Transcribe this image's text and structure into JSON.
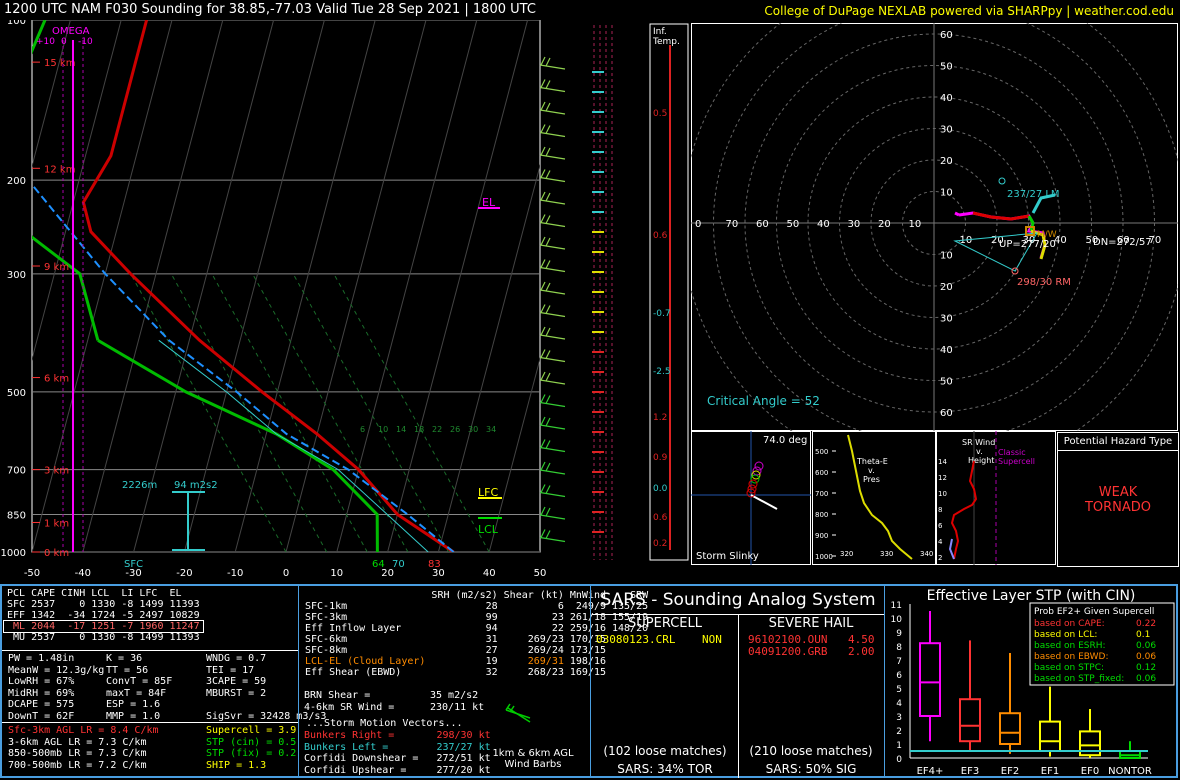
{
  "header": {
    "title": "1200 UTC NAM F030 Sounding for 38.85,-77.03 Valid  Tue 28 Sep 2021 | 1800 UTC",
    "credit": "College of DuPage NEXLAB powered via SHARPpy | weather.cod.edu"
  },
  "skewt": {
    "p_ticks": [
      "100",
      "200",
      "300",
      "500",
      "700",
      "850",
      "1000"
    ],
    "t_ticks": [
      "-50",
      "-40",
      "-30",
      "-20",
      "-10",
      "0",
      "10",
      "20",
      "30",
      "40",
      "50"
    ],
    "heights": [
      "15 km",
      "12 km",
      "9 km",
      "6 km",
      "3 km",
      "1 km",
      "0 km"
    ],
    "omega_label": "OMEGA",
    "omega_ticks": [
      "+10",
      "0",
      "-10"
    ],
    "el_label": "EL",
    "lfc_label": "LFC",
    "lcl_label": "LCL",
    "sfc_label": "SFC",
    "sfc_temp": "64",
    "sfc_dew": "70",
    "sfc_td": "83",
    "effective_inflow_base": "2226m",
    "effective_inflow_srh": "94 m2s2",
    "hodo_inset_speeds": [
      "6",
      "10",
      "14",
      "18",
      "22",
      "26",
      "30",
      "34"
    ]
  },
  "inferred_temp": {
    "label1": "Inf.",
    "label2": "Temp.",
    "values": [
      "0.5",
      "0.6",
      "-0.7",
      "-2.5",
      "1.2",
      "0.9",
      "0.0",
      "0.6",
      "0.2"
    ]
  },
  "hodograph": {
    "ring_labels": [
      "10",
      "20",
      "30",
      "40",
      "50",
      "60"
    ],
    "axis_labels": [
      "0",
      "70",
      "60",
      "50",
      "40",
      "30",
      "20",
      "10"
    ],
    "axis_labels_right": [
      "10",
      "20",
      "30",
      "40",
      "50",
      "60",
      "70"
    ],
    "critical_angle": "Critical Angle = 52",
    "lm_label": "237/27 LM",
    "rm_label": "298/30 RM",
    "up_label": "UP=277/20",
    "dn_label": "DN=272/57",
    "mean_label": "M/W"
  },
  "slinky": {
    "angle": "74.0 deg",
    "label": "Storm Slinky"
  },
  "theta": {
    "title_lines": [
      "Theta-E",
      "v.",
      "Pres"
    ],
    "p_ticks": [
      "500",
      "600",
      "700",
      "800",
      "900",
      "1000"
    ],
    "x_ticks": [
      "320",
      "330",
      "340"
    ]
  },
  "srwind": {
    "title_lines": [
      "SR Wind",
      "v.",
      "Height"
    ],
    "tag_lines": [
      "Classic",
      "Supercell"
    ],
    "h_ticks": [
      "14",
      "12",
      "10",
      "8",
      "6",
      "4",
      "2"
    ]
  },
  "hazard": {
    "title": "Potential Hazard Type",
    "value": "WEAK\nTORNADO"
  },
  "parcels": {
    "headers": [
      "PCL",
      "CAPE",
      "CINH",
      "LCL",
      "LI",
      "LFC",
      "EL"
    ],
    "rows": [
      [
        "SFC",
        "2537",
        "0",
        "1330",
        "-8",
        "1499",
        "11393"
      ],
      [
        "EFF",
        "1342",
        "-34",
        "1724",
        "-5",
        "2497",
        "10829"
      ],
      [
        "ML",
        "2044",
        "-17",
        "1251",
        "-7",
        "1960",
        "11247"
      ],
      [
        "MU",
        "2537",
        "0",
        "1330",
        "-8",
        "1499",
        "11393"
      ]
    ]
  },
  "indices": {
    "col1": [
      "PW = 1.48in",
      "MeanW = 12.3g/kg",
      "LowRH = 67%",
      "MidRH = 69%",
      "DCAPE = 575",
      "DownT = 62F"
    ],
    "col2": [
      "K = 36",
      "TT = 56",
      "ConvT = 85F",
      "maxT = 84F",
      "ESP = 1.6",
      "MMP = 1.0"
    ],
    "col3": [
      "WNDG = 0.7",
      "TEI = 17",
      "3CAPE = 59",
      "MBURST = 2",
      "",
      "SigSvr = 32428 m3/s3"
    ],
    "lapse": [
      "Sfc-3km AGL LR = 8.4 C/km",
      "3-6km AGL LR = 7.3 C/km",
      "850-500mb LR = 7.3 C/km",
      "700-500mb LR = 7.2 C/km"
    ],
    "composite": [
      "Supercell = 3.9",
      "STP (cin) = 0.5",
      "STP (fix) = 0.2",
      "SHIP = 1.3"
    ]
  },
  "kinematics": {
    "headers": [
      "",
      "SRH (m2/s2)",
      "Shear (kt)",
      "MnWind",
      "SRW"
    ],
    "rows": [
      [
        "SFC-1km",
        "28",
        "6",
        "249/9",
        "135/25"
      ],
      [
        "SFC-3km",
        "99",
        "23",
        "261/18",
        "155/19"
      ],
      [
        "Eff Inflow Layer",
        "94",
        "22",
        "259/16",
        "148/20"
      ],
      [
        "",
        "",
        "",
        "",
        ""
      ],
      [
        "SFC-6km",
        "31",
        "269/23",
        "170/15",
        ""
      ],
      [
        "SFC-8km",
        "27",
        "269/24",
        "173/15",
        ""
      ],
      [
        "LCL-EL (Cloud Layer)",
        "19",
        "269/31",
        "198/16",
        ""
      ],
      [
        "Eff Shear (EBWD)",
        "32",
        "268/23",
        "169/15",
        ""
      ]
    ],
    "brn_shear": "BRN Shear =",
    "brn_shear_val": "35 m2/s2",
    "sr_wind": "4-6km SR Wind =",
    "sr_wind_val": "230/11 kt",
    "storm_motion_title": "...Storm Motion Vectors...",
    "motions": [
      [
        "Bunkers Right =",
        "298/30 kt"
      ],
      [
        "Bunkers Left =",
        "237/27 kt"
      ],
      [
        "Corfidi Downshear =",
        "272/51 kt"
      ],
      [
        "Corfidi Upshear =",
        "277/20 kt"
      ]
    ],
    "barb_label1": "1km & 6km AGL",
    "barb_label2": "Wind Barbs"
  },
  "sars": {
    "title": "SARS - Sounding Analog System",
    "supercell_title": "SUPERCELL",
    "hail_title": "SEVERE HAIL",
    "supercell_match": "03080123.CRL",
    "supercell_match_type": "NON",
    "hail_matches": [
      [
        "96102100.OUN",
        "4.50"
      ],
      [
        "04091200.GRB",
        "2.00"
      ]
    ],
    "supercell_loose": "(102 loose matches)",
    "hail_loose": "(210 loose matches)",
    "supercell_stat": "SARS: 34% TOR",
    "hail_stat": "SARS: 50% SIG"
  },
  "stp": {
    "title": "Effective Layer STP (with CIN)",
    "y_ticks": [
      "0",
      "1",
      "2",
      "3",
      "4",
      "5",
      "6",
      "7",
      "8",
      "9",
      "10",
      "11"
    ],
    "categories": [
      "EF4+",
      "EF3",
      "EF2",
      "EF1",
      "EF0",
      "NONTOR"
    ],
    "legend_title": "Prob EF2+ Given Supercell",
    "legend_rows": [
      [
        "based on CAPE:",
        "0.22"
      ],
      [
        "based on LCL:",
        "0.1"
      ],
      [
        "based on ESRH:",
        "0.06"
      ],
      [
        "based on EBWD:",
        "0.06"
      ],
      [
        "based on STPC:",
        "0.12"
      ],
      [
        "based on STP_fixed:",
        "0.06"
      ]
    ]
  },
  "colors": {
    "temp": "#cc0000",
    "dew": "#00bb00",
    "parcel": "#1e90ff",
    "accent": "#ffff00",
    "panel_border": "#4a9ee0"
  },
  "chart_data": [
    {
      "type": "line",
      "title": "Skew-T",
      "xlabel": "",
      "ylabel": "",
      "xlim": [
        -50,
        50
      ],
      "ylim": [
        1000,
        100
      ],
      "series": [
        {
          "name": "",
          "x": [
            33,
            20,
            10,
            0,
            -13,
            -28,
            -45
          ],
          "y": [
            1000,
            850,
            700,
            600,
            500,
            400,
            300
          ]
        },
        {
          "name": "",
          "x": [
            18,
            16,
            5,
            -8,
            -28,
            -48
          ],
          "y": [
            1000,
            850,
            700,
            600,
            500,
            400
          ]
        }
      ]
    },
    {
      "type": "bar",
      "title": "Effective Layer STP (with CIN)",
      "categories": [
        "EF4+",
        "EF3",
        "EF2",
        "EF1",
        "EF0",
        "NONTOR"
      ],
      "series": [
        {
          "name": "",
          "values": [
            5.4,
            2.3,
            1.8,
            1.2,
            0.9,
            0.2
          ]
        }
      ],
      "ylim": [
        0,
        11
      ]
    }
  ]
}
